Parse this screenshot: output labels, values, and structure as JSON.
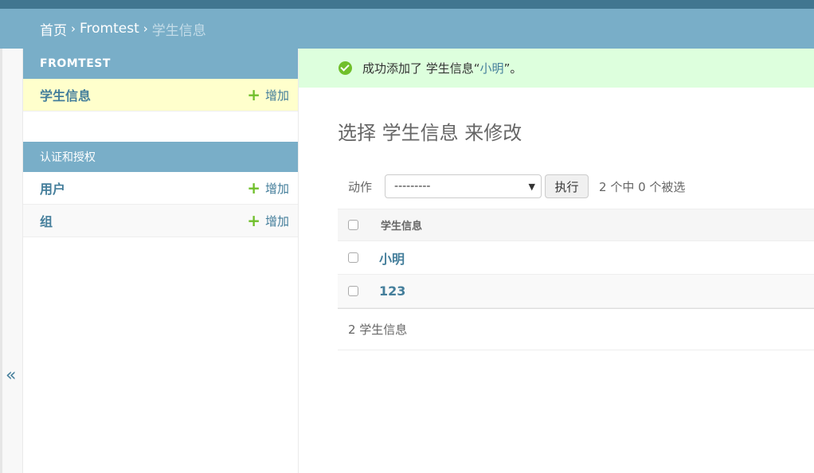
{
  "breadcrumb": {
    "home": "首页",
    "app": "Fromtest",
    "current": "学生信息",
    "separator": "›"
  },
  "sidebar": {
    "collapse_toggle": "«",
    "modules": [
      {
        "caption": "FROMTEST",
        "models": [
          {
            "name": "学生信息",
            "add_label": "增加"
          }
        ]
      },
      {
        "caption": "认证和授权",
        "models": [
          {
            "name": "用户",
            "add_label": "增加"
          },
          {
            "name": "组",
            "add_label": "增加"
          }
        ]
      }
    ]
  },
  "message": {
    "prefix": "成功添加了 学生信息“",
    "object": "小明",
    "suffix": "”。"
  },
  "page_title": "选择 学生信息 来修改",
  "actions": {
    "label": "动作",
    "selected": "---------",
    "go_label": "执行",
    "counter": "2 个中 0 个被选"
  },
  "table": {
    "column": "学生信息",
    "rows": [
      "小明",
      "123"
    ]
  },
  "paginator": "2 学生信息",
  "colors": {
    "header": "#417690",
    "breadcrumb": "#79aec8",
    "link": "#447e9b",
    "add": "#70bf2b",
    "success_bg": "#ddffdd",
    "current_row": "#ffffcc"
  }
}
